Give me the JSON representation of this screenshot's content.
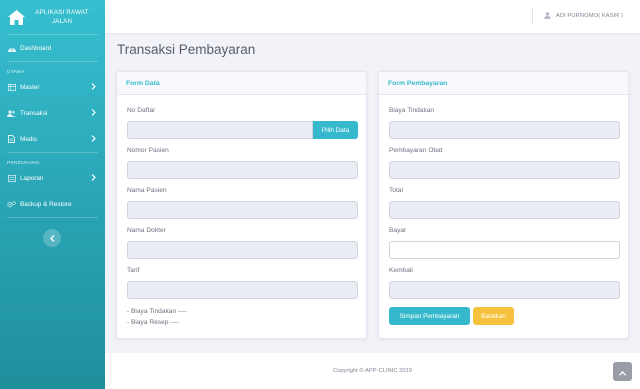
{
  "app": {
    "brand": "APLIKASI RAWAT JALAN"
  },
  "colors": {
    "sidebar": "#36bfd0",
    "accent": "#36b9cc",
    "primary_button": "#36b9cc",
    "warning_button": "#f6c23e"
  },
  "sidebar": {
    "dashboard": {
      "label": "Dashboard",
      "icon": "dashboard-icon"
    },
    "section_utama": "UTAMA",
    "items_utama": [
      {
        "label": "Master",
        "icon": "table-icon"
      },
      {
        "label": "Transaksi",
        "icon": "users-icon"
      },
      {
        "label": "Medis",
        "icon": "file-icon"
      }
    ],
    "section_pendukung": "PENDUKUNG",
    "items_pendukung": [
      {
        "label": "Laporan",
        "icon": "report-icon"
      },
      {
        "label": "Backup & Restore",
        "icon": "gears-icon"
      }
    ]
  },
  "topbar": {
    "user": "ADI PURNOMO( KASIR )"
  },
  "page": {
    "title": "Transaksi Pembayaran"
  },
  "form_data": {
    "title": "Form Data",
    "no_daftar": "No Daftar",
    "pilih_data": "Pilih Data",
    "nomor_pasien": "Nomor Pasien",
    "nama_pasien": "Nama Pasien",
    "nama_dokter": "Nama Dokter",
    "tarif": "Tarif",
    "biaya_tindakan_note": "- Biaya Tindakan ----",
    "biaya_resep_note": "- Biaya Resep ----"
  },
  "form_pembayaran": {
    "title": "Form Pembayaran",
    "biaya_tindakan": "Biaya Tindakan",
    "pembayaran_obat": "Pembayaran Obat",
    "total": "Total",
    "bayar": "Bayar",
    "kembali": "Kembali",
    "simpan": "Simpan Pembayaran",
    "batalkan": "Batalkan"
  },
  "footer": {
    "copyright": "Copyright © APP-CLINIC 2019"
  }
}
